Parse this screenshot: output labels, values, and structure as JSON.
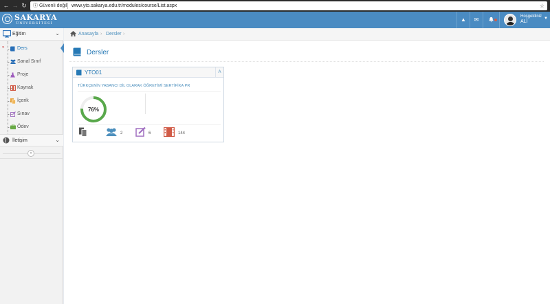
{
  "browser": {
    "security_label": "Güvenli değil",
    "url": "www.yto.sakarya.edu.tr/modules/course/List.aspx"
  },
  "header": {
    "logo_name": "SAKARYA",
    "logo_sub": "ÜNİVERSİTESİ",
    "greeting": "Hoşgeldiniz",
    "user_name": "ALİ",
    "brand_color": "#4a8bc2"
  },
  "sidebar": {
    "groups": [
      {
        "label": "Eğitim",
        "icon": "monitor-icon"
      },
      {
        "label": "İletişim",
        "icon": "globe-icon"
      }
    ],
    "items": [
      {
        "label": "Ders",
        "icon": "book-icon",
        "active": true
      },
      {
        "label": "Sanal Sınıf",
        "icon": "users-icon"
      },
      {
        "label": "Proje",
        "icon": "flask-icon"
      },
      {
        "label": "Kaynak",
        "icon": "film-icon"
      },
      {
        "label": "İçerik",
        "icon": "files-icon"
      },
      {
        "label": "Sınav",
        "icon": "edit-icon"
      },
      {
        "label": "Ödev",
        "icon": "briefcase-icon"
      }
    ]
  },
  "breadcrumb": {
    "home": "Anasayfa",
    "current": "Dersler"
  },
  "page": {
    "title": "Dersler"
  },
  "course": {
    "code": "YTO01",
    "badge": "A",
    "title": "TÜRKÇENİN YABANCI DİL OLARAK ÖĞRETİMİ SERTİFİKA PR",
    "progress_percent": 76,
    "progress_label": "76%",
    "progress_color": "#59a84b",
    "stats": [
      {
        "icon": "copy-icon",
        "value": ""
      },
      {
        "icon": "users-icon",
        "value": "2"
      },
      {
        "icon": "edit-icon",
        "value": "6"
      },
      {
        "icon": "film-icon",
        "value": "144"
      }
    ]
  }
}
